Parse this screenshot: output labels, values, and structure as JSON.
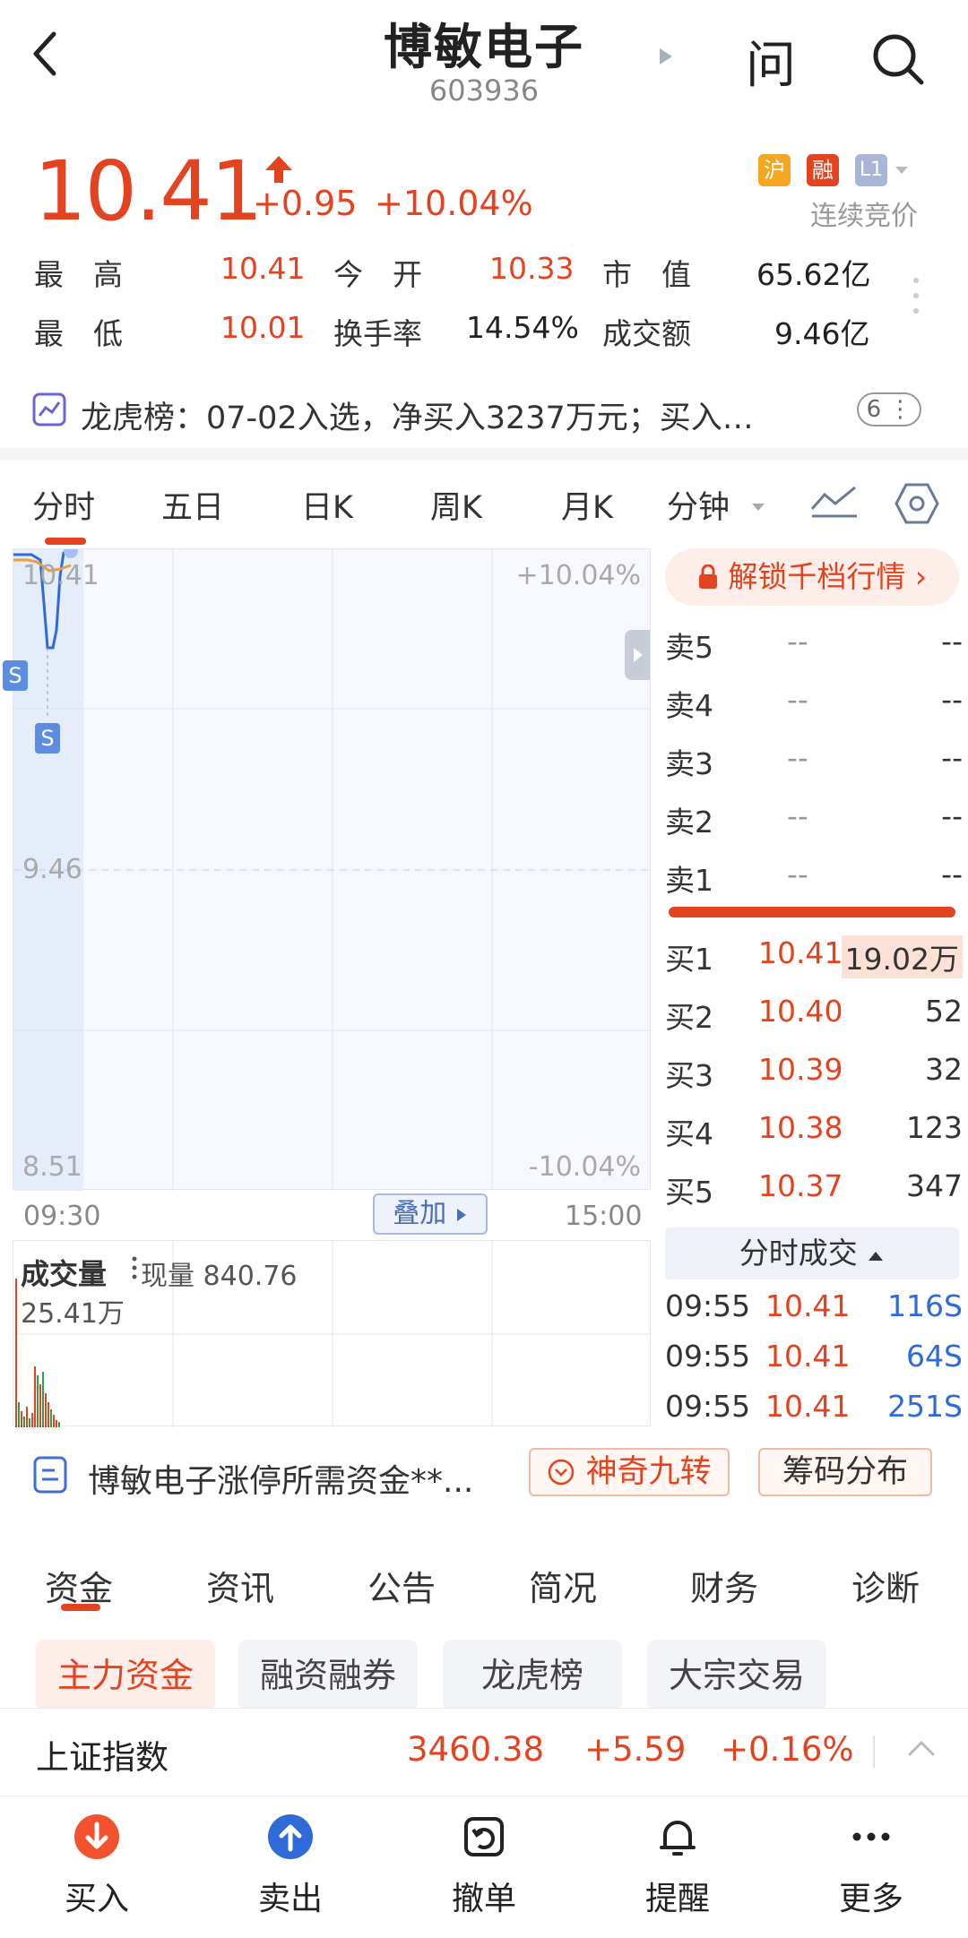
{
  "header": {
    "title": "博敏电子",
    "code": "603936",
    "ask_label": "问"
  },
  "quote": {
    "price": "10.41",
    "change": "+0.95",
    "change_pct": "+10.04%",
    "tags": [
      "沪",
      "融",
      "L1"
    ],
    "tag_colors": [
      "#f5a623",
      "#e4431f",
      "#a9b6d8"
    ],
    "status": "连续竞价",
    "stats": [
      {
        "label": "最　高",
        "value": "10.41"
      },
      {
        "label": "今　开",
        "value": "10.33"
      },
      {
        "label": "市　值",
        "value": "65.62亿"
      },
      {
        "label": "最　低",
        "value": "10.01"
      },
      {
        "label": "换手率",
        "value": "14.54%"
      },
      {
        "label": "成交额",
        "value": "9.46亿"
      }
    ]
  },
  "lhb": {
    "text": "龙虎榜：07-02入选，净买入3237万元；买入…",
    "badge": "6"
  },
  "tabs": [
    "分时",
    "五日",
    "日K",
    "周K",
    "月K",
    "分钟"
  ],
  "chart": {
    "price_high": "10.41",
    "pct_high": "+10.04%",
    "price_mid": "9.46",
    "price_low": "8.51",
    "pct_low": "-10.04%",
    "time_start": "09:30",
    "time_end": "15:00",
    "overlay_btn": "叠加",
    "sell_marker": "S",
    "volume_label": "成交量",
    "current_vol": "现量 840.76",
    "vol_max": "25.41万"
  },
  "orderbook": {
    "unlock": "解锁千档行情",
    "asks": [
      {
        "label": "卖5",
        "price": "--",
        "vol": "--"
      },
      {
        "label": "卖4",
        "price": "--",
        "vol": "--"
      },
      {
        "label": "卖3",
        "price": "--",
        "vol": "--"
      },
      {
        "label": "卖2",
        "price": "--",
        "vol": "--"
      },
      {
        "label": "卖1",
        "price": "--",
        "vol": "--"
      }
    ],
    "bids": [
      {
        "label": "买1",
        "price": "10.41",
        "vol": "19.02万"
      },
      {
        "label": "买2",
        "price": "10.40",
        "vol": "52"
      },
      {
        "label": "买3",
        "price": "10.39",
        "vol": "32"
      },
      {
        "label": "买4",
        "price": "10.38",
        "vol": "123"
      },
      {
        "label": "买5",
        "price": "10.37",
        "vol": "347"
      }
    ],
    "trades_header": "分时成交",
    "trades": [
      {
        "time": "09:55",
        "price": "10.41",
        "vol": "116S"
      },
      {
        "time": "09:55",
        "price": "10.41",
        "vol": "64S"
      },
      {
        "time": "09:55",
        "price": "10.41",
        "vol": "251S"
      }
    ]
  },
  "news_bar": {
    "text": "博敏电子涨停所需资金**...",
    "btn1": "神奇九转",
    "btn2": "筹码分布"
  },
  "sub_tabs": [
    "资金",
    "资讯",
    "公告",
    "简况",
    "财务",
    "诊断"
  ],
  "fund_pills": [
    "主力资金",
    "融资融券",
    "龙虎榜",
    "大宗交易"
  ],
  "index_bar": {
    "name": "上证指数",
    "value": "3460.38",
    "change": "+5.59",
    "pct": "+0.16%"
  },
  "bottom_nav": [
    "买入",
    "卖出",
    "撤单",
    "提醒",
    "更多"
  ],
  "colors": {
    "up": "#e4431f",
    "down": "#2f6bd8",
    "accent": "#e4431f"
  }
}
